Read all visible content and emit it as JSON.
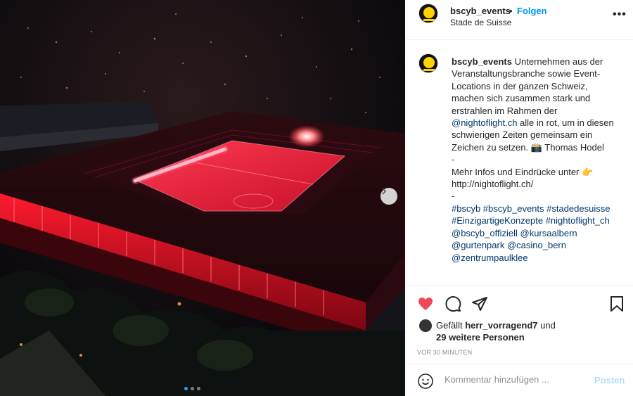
{
  "post": {
    "username": "bscyb_events",
    "separator": "•",
    "follow_label": "Folgen",
    "location": "Stade de Suisse",
    "more_icon": "more-horizontal-icon"
  },
  "caption": {
    "username": "bscyb_events",
    "text_1": " Unternehmen aus der Veranstaltungsbranche sowie Event-Locations in der ganzen Schweiz, machen sich zusammen stark und erstrahlen im Rahmen der ",
    "mention_1": "@nightoflight.ch",
    "text_2": " alle in rot, um in diesen schwierigen Zeiten gemeinsam ein Zeichen zu setzen. 📸 Thomas Hodel",
    "dash_1": "-",
    "more_info": "Mehr Infos und Eindrücke unter 👉 http://nightoflight.ch/",
    "dash_2": "-",
    "hashtags": "#bscyb #bscyb_events #stadedesuisse #EinzigartigeKonzepte #nightoflight_ch",
    "mentions": "@bscyb_offiziell @kursaalbern @gurtenpark @casino_bern @zentrumpaulklee"
  },
  "actions": {
    "liked_by_prefix": "Gefällt ",
    "liked_by_user": "herr_vorragend7",
    "liked_by_suffix": " und",
    "others": "29 weitere Personen",
    "timestamp": "VOR 30 MINUTEN"
  },
  "comment": {
    "placeholder": "Kommentar hinzufügen ...",
    "post_label": "Posten"
  },
  "colors": {
    "follow": "#0095f6",
    "like_heart": "#ed4956",
    "post_disabled": "#b2dffc",
    "stadium_glow": "#ff1a2e"
  }
}
